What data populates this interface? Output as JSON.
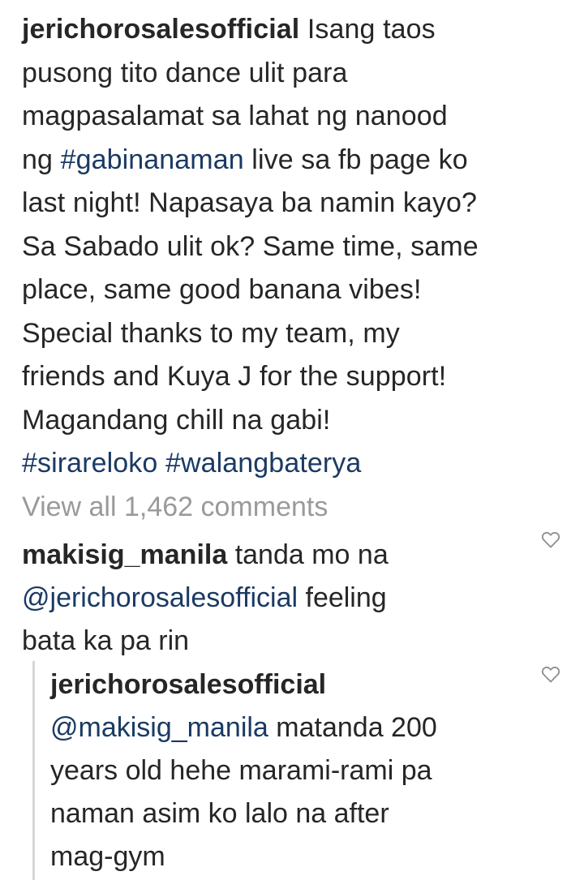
{
  "post": {
    "username": "jerichorosalesofficial",
    "caption_lines": [
      "Isang taos",
      "pusong tito dance ulit para",
      "magpasalamat sa lahat ng nanood",
      "ng",
      " live sa fb page ko",
      "last night! Napasaya ba namin kayo?",
      "Sa Sabado ulit ok? Same time, same",
      "place, same good banana vibes!",
      "Special thanks to my team, my",
      "friends and Kuya J for the support!",
      "Magandang chill na gabi!"
    ],
    "hashtag_inline": "#gabinanaman",
    "hashtags": [
      "#sirareloko",
      "#walangbaterya"
    ]
  },
  "view_all_comments": "View all 1,462 comments",
  "comments": [
    {
      "username": "makisig_manila",
      "text_before": " tanda mo na",
      "mention": "@jerichorosalesofficial",
      "text_after": " feeling",
      "text_end": "bata ka pa rin",
      "like_icon": "heart-outline-icon"
    }
  ],
  "reply": {
    "username": "jerichorosalesofficial",
    "mention": "@makisig_manila",
    "text_line1": " matanda 200",
    "text_line2": "years old hehe marami-rami pa",
    "text_line3": "naman asim ko lalo na after",
    "text_line4": "mag-gym",
    "like_icon": "heart-outline-icon"
  },
  "colors": {
    "text": "#262626",
    "link": "#1a3a63",
    "muted": "#9a9a9a"
  }
}
